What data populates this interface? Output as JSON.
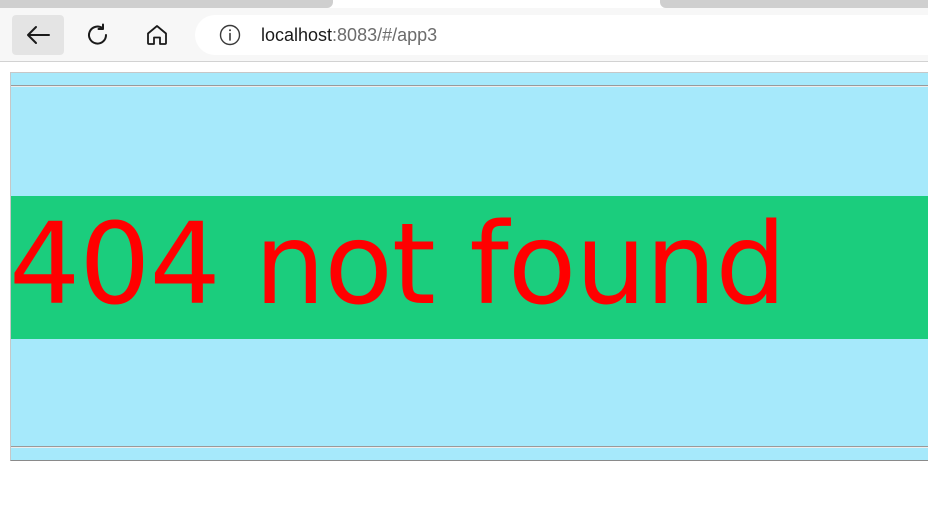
{
  "browser": {
    "back_icon": "arrow-left-icon",
    "reload_icon": "reload-icon",
    "home_icon": "home-icon",
    "info_icon": "info-icon",
    "address": {
      "host": "localhost",
      "rest": ":8083/#/app3"
    }
  },
  "page": {
    "message": "404 not found",
    "colors": {
      "background": "#a6e9fb",
      "band": "#1bcd7d",
      "text": "#ff0000"
    }
  }
}
